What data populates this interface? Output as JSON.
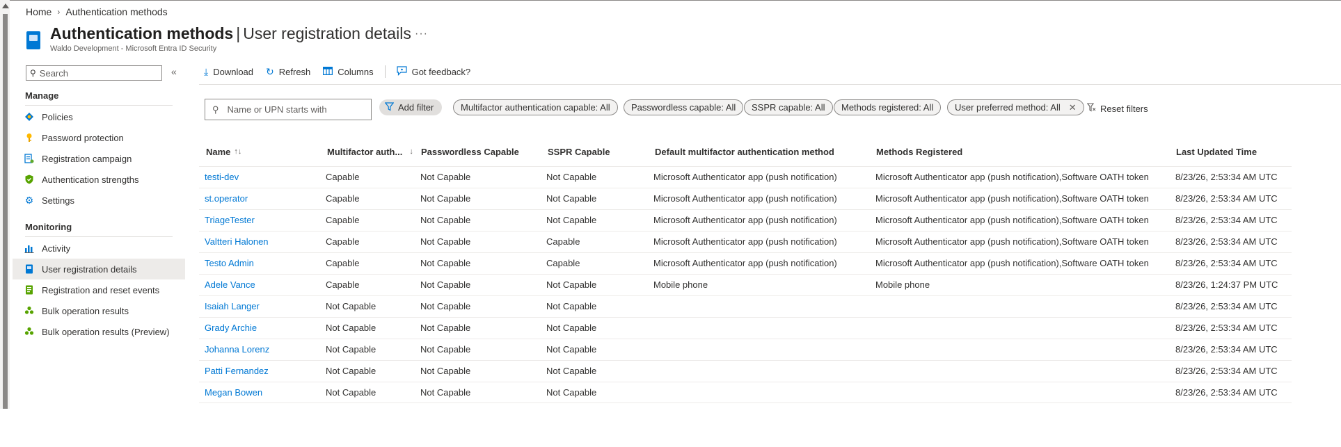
{
  "breadcrumb": {
    "home": "Home",
    "current": "Authentication methods"
  },
  "header": {
    "title": "Authentication methods",
    "separator": "|",
    "subtitle_page": "User registration details",
    "more": "···",
    "tenant": "Waldo Development - Microsoft Entra ID Security"
  },
  "sidebar": {
    "search_placeholder": "Search",
    "collapse": "«",
    "sections": [
      {
        "heading": "Manage",
        "items": [
          {
            "label": "Policies",
            "icon": "policy-icon"
          },
          {
            "label": "Password protection",
            "icon": "key-icon"
          },
          {
            "label": "Registration campaign",
            "icon": "campaign-icon"
          },
          {
            "label": "Authentication strengths",
            "icon": "shield-icon"
          },
          {
            "label": "Settings",
            "icon": "gear-icon"
          }
        ]
      },
      {
        "heading": "Monitoring",
        "items": [
          {
            "label": "Activity",
            "icon": "bar-chart-icon"
          },
          {
            "label": "User registration details",
            "icon": "user-details-icon",
            "active": true
          },
          {
            "label": "Registration and reset events",
            "icon": "events-icon"
          },
          {
            "label": "Bulk operation results",
            "icon": "people-icon"
          },
          {
            "label": "Bulk operation results (Preview)",
            "icon": "people-icon"
          }
        ]
      }
    ]
  },
  "toolbar": {
    "download": "Download",
    "refresh": "Refresh",
    "columns": "Columns",
    "feedback": "Got feedback?"
  },
  "filters": {
    "name_placeholder": "Name or UPN starts with",
    "add_filter": "Add filter",
    "pills": [
      "Multifactor authentication capable: All",
      "Passwordless capable: All",
      "SSPR capable: All",
      "Methods registered: All",
      "User preferred method: All"
    ],
    "reset": "Reset filters"
  },
  "table": {
    "headers": {
      "name": "Name",
      "name_sort": "↑↓",
      "mfa": "Multifactor auth...",
      "mfa_sort": "↓",
      "passwordless": "Passwordless Capable",
      "sspr": "SSPR Capable",
      "default_method": "Default multifactor authentication method",
      "methods": "Methods Registered",
      "updated": "Last Updated Time"
    },
    "rows": [
      {
        "name": "testi-dev",
        "mfa": "Capable",
        "passwordless": "Not Capable",
        "sspr": "Not Capable",
        "default_method": "Microsoft Authenticator app (push notification)",
        "methods": "Microsoft Authenticator app (push notification),Software OATH token",
        "updated": "8/23/26, 2:53:34 AM UTC"
      },
      {
        "name": "st.operator",
        "mfa": "Capable",
        "passwordless": "Not Capable",
        "sspr": "Not Capable",
        "default_method": "Microsoft Authenticator app (push notification)",
        "methods": "Microsoft Authenticator app (push notification),Software OATH token",
        "updated": "8/23/26, 2:53:34 AM UTC"
      },
      {
        "name": "TriageTester",
        "mfa": "Capable",
        "passwordless": "Not Capable",
        "sspr": "Not Capable",
        "default_method": "Microsoft Authenticator app (push notification)",
        "methods": "Microsoft Authenticator app (push notification),Software OATH token",
        "updated": "8/23/26, 2:53:34 AM UTC"
      },
      {
        "name": "Valtteri Halonen",
        "mfa": "Capable",
        "passwordless": "Not Capable",
        "sspr": "Capable",
        "default_method": "Microsoft Authenticator app (push notification)",
        "methods": "Microsoft Authenticator app (push notification),Software OATH token",
        "updated": "8/23/26, 2:53:34 AM UTC"
      },
      {
        "name": "Testo Admin",
        "mfa": "Capable",
        "passwordless": "Not Capable",
        "sspr": "Capable",
        "default_method": "Microsoft Authenticator app (push notification)",
        "methods": "Microsoft Authenticator app (push notification),Software OATH token",
        "updated": "8/23/26, 2:53:34 AM UTC"
      },
      {
        "name": "Adele Vance",
        "mfa": "Capable",
        "passwordless": "Not Capable",
        "sspr": "Not Capable",
        "default_method": "Mobile phone",
        "methods": "Mobile phone",
        "updated": "8/23/26, 1:24:37 PM UTC"
      },
      {
        "name": "Isaiah Langer",
        "mfa": "Not Capable",
        "passwordless": "Not Capable",
        "sspr": "Not Capable",
        "default_method": "",
        "methods": "",
        "updated": "8/23/26, 2:53:34 AM UTC"
      },
      {
        "name": "Grady Archie",
        "mfa": "Not Capable",
        "passwordless": "Not Capable",
        "sspr": "Not Capable",
        "default_method": "",
        "methods": "",
        "updated": "8/23/26, 2:53:34 AM UTC"
      },
      {
        "name": "Johanna Lorenz",
        "mfa": "Not Capable",
        "passwordless": "Not Capable",
        "sspr": "Not Capable",
        "default_method": "",
        "methods": "",
        "updated": "8/23/26, 2:53:34 AM UTC"
      },
      {
        "name": "Patti Fernandez",
        "mfa": "Not Capable",
        "passwordless": "Not Capable",
        "sspr": "Not Capable",
        "default_method": "",
        "methods": "",
        "updated": "8/23/26, 2:53:34 AM UTC"
      },
      {
        "name": "Megan Bowen",
        "mfa": "Not Capable",
        "passwordless": "Not Capable",
        "sspr": "Not Capable",
        "default_method": "",
        "methods": "",
        "updated": "8/23/26, 2:53:34 AM UTC"
      }
    ]
  },
  "colors": {
    "accent": "#0078d4",
    "active_bg": "#edebe9",
    "border": "#8a8886",
    "text": "#323130"
  }
}
